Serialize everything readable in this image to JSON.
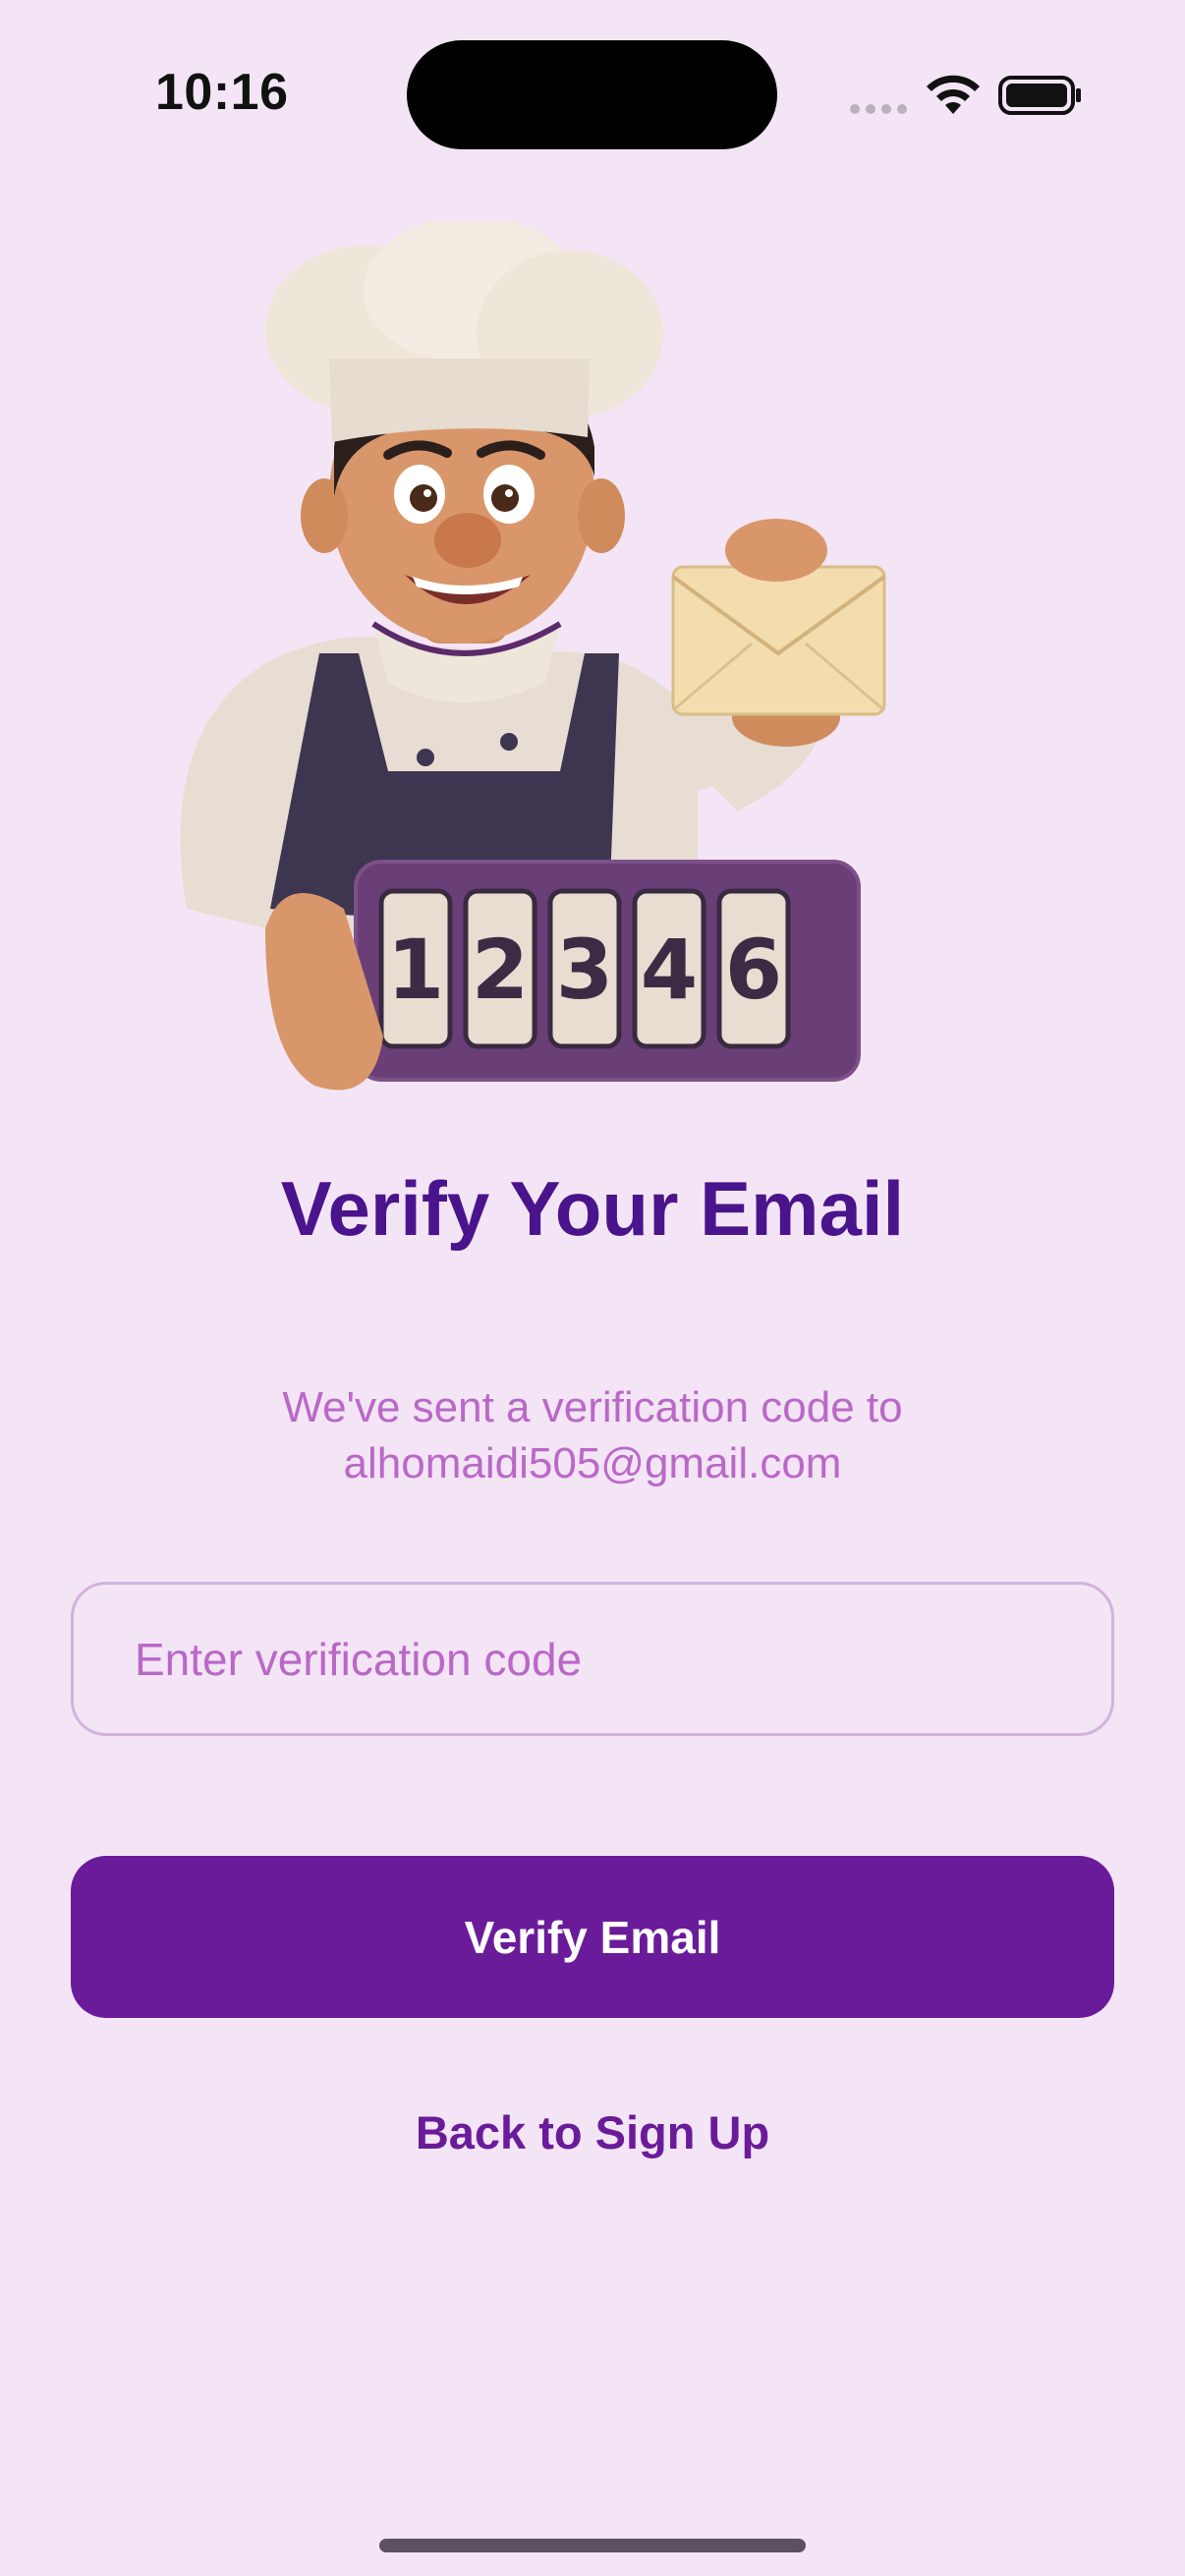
{
  "status_bar": {
    "time": "10:16"
  },
  "illustration": {
    "counter_digits": [
      "1",
      "2",
      "3",
      "4",
      "6"
    ]
  },
  "header": {
    "title": "Verify Your Email"
  },
  "message": {
    "line1": "We've sent a verification code to",
    "email": "alhomaidi505@gmail.com"
  },
  "form": {
    "code_placeholder": "Enter verification code",
    "code_value": ""
  },
  "actions": {
    "verify_label": "Verify Email",
    "back_label": "Back to Sign Up"
  },
  "colors": {
    "background": "#f3e5f5",
    "title": "#4a148c",
    "subtitle": "#ba68c8",
    "primary": "#6a1b9a"
  }
}
